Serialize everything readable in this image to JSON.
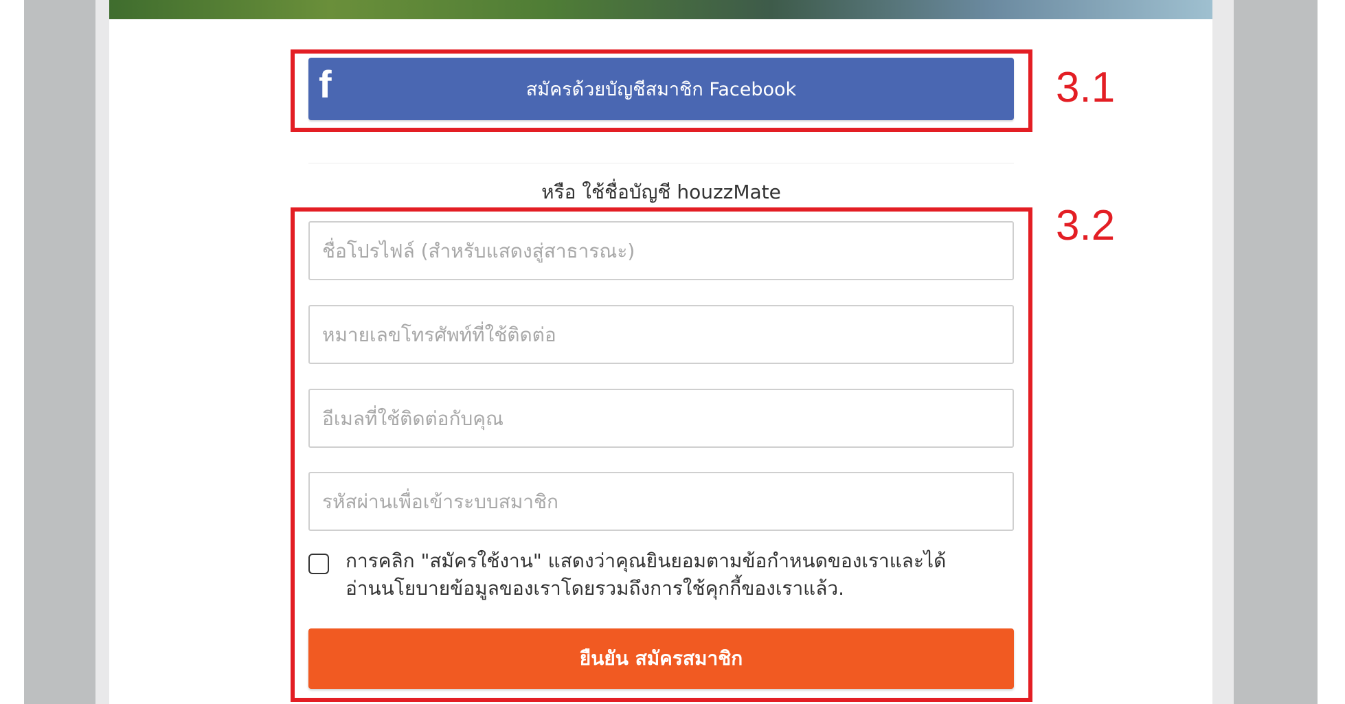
{
  "facebook": {
    "icon": "f",
    "label": "สมัครด้วยบัญชีสมาชิก Facebook",
    "color": "#4a67b2"
  },
  "divider_text": "หรือ ใช้ชื่อบัญชี houzzMate",
  "form": {
    "profile_name_placeholder": "ชื่อโปรไฟล์ (สำหรับแสดงสู่สาธารณะ)",
    "phone_placeholder": "หมายเลขโทรศัพท์ที่ใช้ติดต่อ",
    "email_placeholder": "อีเมลที่ใช้ติดต่อกับคุณ",
    "password_placeholder": "รหัสผ่านเพื่อเข้าระบบสมาชิก",
    "terms_line1": "การคลิก \"สมัครใช้งาน\" แสดงว่าคุณยินยอมตามข้อกำหนดของเราและได้",
    "terms_line2": "อ่านนโยบายข้อมูลของเราโดยรวมถึงการใช้คุกกี้ของเราแล้ว.",
    "submit_label": "ยืนยัน สมัครสมาชิก",
    "submit_color": "#f15a22"
  },
  "annotations": {
    "label_31": "3.1",
    "label_32": "3.2",
    "color": "#e31e24"
  }
}
